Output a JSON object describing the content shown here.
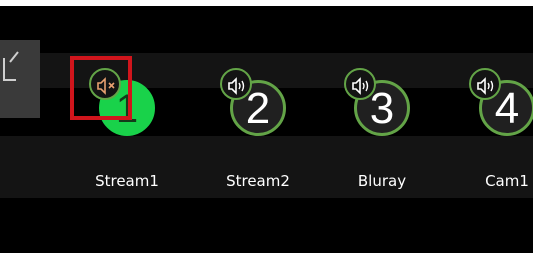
{
  "sources": [
    {
      "label": "Stream1",
      "number": "1",
      "active": true,
      "audio": "muted",
      "audio_icon": "speaker-muted-icon"
    },
    {
      "label": "Stream2",
      "number": "2",
      "active": false,
      "audio": "on",
      "audio_icon": "speaker-icon"
    },
    {
      "label": "Bluray",
      "number": "3",
      "active": false,
      "audio": "on",
      "audio_icon": "speaker-icon"
    },
    {
      "label": "Cam1",
      "number": "4",
      "active": false,
      "audio": "on",
      "audio_icon": "speaker-icon"
    }
  ],
  "colors": {
    "active_green": "#19d24a",
    "ring_green": "#63a447",
    "muted_icon": "#e8a070",
    "highlight_red": "#d0151c"
  }
}
